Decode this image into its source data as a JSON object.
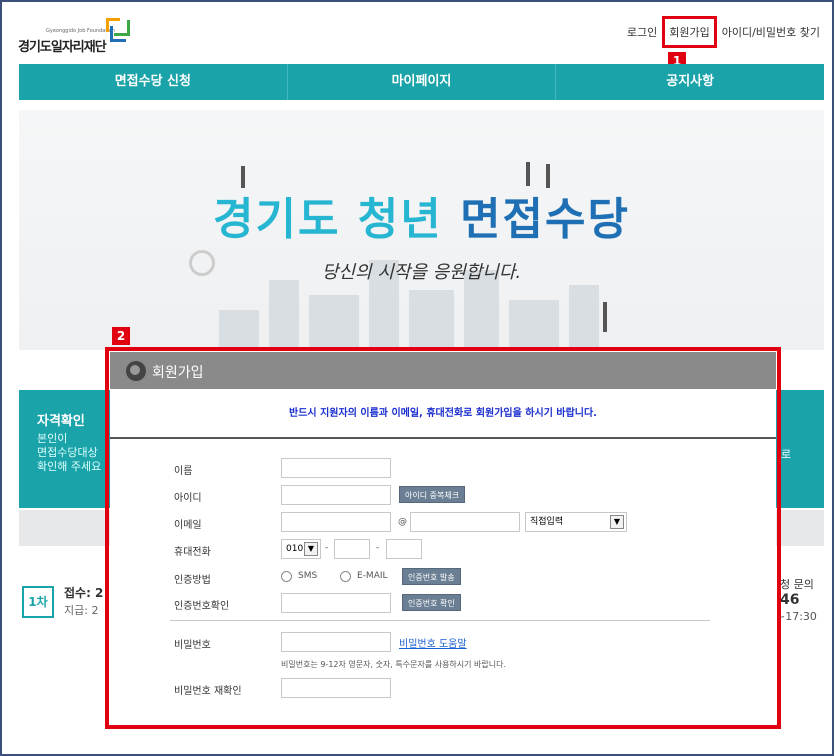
{
  "header": {
    "logo_small": "Gyeonggido Job Foundation",
    "logo_main": "경기도일자리재단",
    "links": [
      "로그인",
      "회원가입",
      "아이디/비밀번호 찾기"
    ]
  },
  "nav": [
    "면접수당 신청",
    "마이페이지",
    "공지사항"
  ],
  "hero": {
    "title_part1": "경기도 청년",
    "title_part2": "면접수당",
    "subtitle": "당신의 시작을 응원합니다."
  },
  "markers": [
    "1",
    "2"
  ],
  "background": {
    "qual_title": "자격확인",
    "qual_lines": [
      "본인이",
      "면접수당대상",
      "확인해 주세요"
    ],
    "right_text": "로",
    "round": "1차",
    "receipt": "접수: 2",
    "payment": "지급: 2",
    "inquiry": "청 문의",
    "phone_tail": "46",
    "hours_tail": "~17:30"
  },
  "modal": {
    "title": "회원가입",
    "notice": "반드시 지원자의 이름과 이메일, 휴대전화로 회원가입을 하시기 바랍니다.",
    "fields": {
      "name": "이름",
      "id": "아이디",
      "email": "이메일",
      "phone": "휴대전화",
      "auth_method": "인증방법",
      "auth_confirm": "인증번호확인",
      "password": "비밀번호",
      "password_confirm": "비밀번호 재확인"
    },
    "buttons": {
      "id_check": "아이디 중복체크",
      "send_code": "인증번호 발송",
      "confirm_code": "인증번호 확인"
    },
    "email_at": "@",
    "email_domain_select": "직접입력",
    "phone_prefix": "010",
    "phone_dash": "-",
    "auth_options": [
      "SMS",
      "E-MAIL"
    ],
    "password_help_link": "비밀번호 도움말",
    "password_hint": "비밀번호는 9-12자 영문자, 숫자, 특수문자를 사용하시기 바랍니다."
  },
  "colors": {
    "teal": "#1aa3a9",
    "highlight_red": "#e1000f",
    "hero_cyan": "#27b6d2",
    "hero_blue": "#1e6fb4"
  }
}
